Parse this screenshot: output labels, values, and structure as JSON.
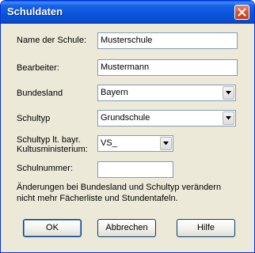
{
  "window": {
    "title": "Schuldaten"
  },
  "fields": {
    "name_label": "Name der Schule:",
    "name_value": "Musterschule",
    "bearbeiter_label": "Bearbeiter:",
    "bearbeiter_value": "Mustermann",
    "bundesland_label": "Bundesland",
    "bundesland_value": "Bayern",
    "schultyp_label": "Schultyp",
    "schultyp_value": "Grundschule",
    "schultyp_bayr_label_1": "Schultyp lt. bayr.",
    "schultyp_bayr_label_2": "Kultusministerium:",
    "schultyp_bayr_value": "VS_",
    "schulnummer_label": "Schulnummer:",
    "schulnummer_value": ""
  },
  "note": {
    "line1": "Änderungen bei Bundesland und Schultyp verändern",
    "line2": "nicht mehr Fächerliste und Stundentafeln."
  },
  "buttons": {
    "ok": "OK",
    "abbrechen": "Abbrechen",
    "hilfe": "Hilfe"
  }
}
